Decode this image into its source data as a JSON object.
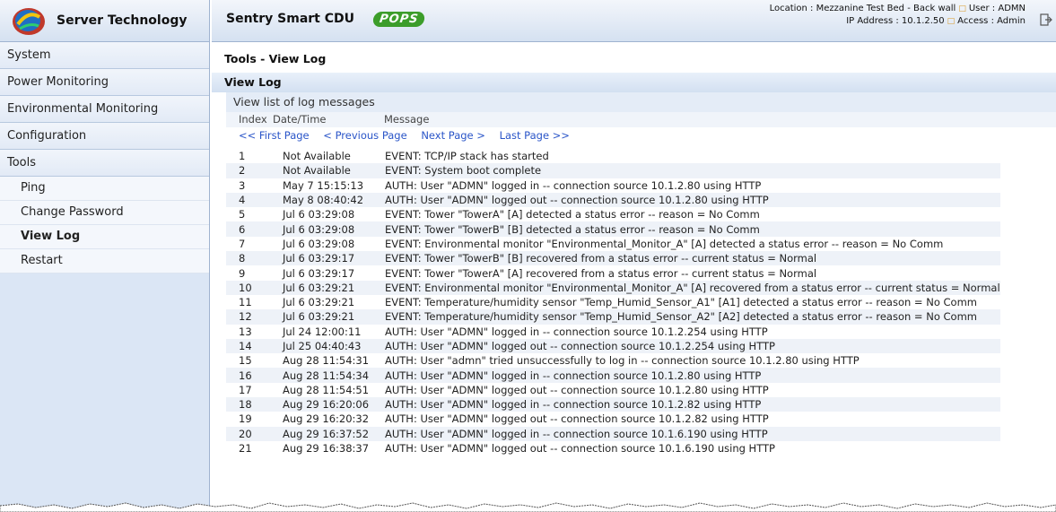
{
  "brand": {
    "name": "Server Technology"
  },
  "header": {
    "product": "Sentry Smart CDU",
    "badge": "POPS",
    "location_label": "Location : Mezzanine Test Bed - Back wall",
    "user_label": "User : ADMN",
    "ip_label": "IP Address : 10.1.2.50",
    "access_label": "Access : Admin"
  },
  "sidebar": {
    "items": [
      {
        "label": "System"
      },
      {
        "label": "Power Monitoring"
      },
      {
        "label": "Environmental Monitoring"
      },
      {
        "label": "Configuration"
      },
      {
        "label": "Tools"
      }
    ],
    "subitems": [
      {
        "label": "Ping"
      },
      {
        "label": "Change Password"
      },
      {
        "label": "View Log"
      },
      {
        "label": "Restart"
      }
    ]
  },
  "main": {
    "page_title": "Tools - View Log",
    "section": "View Log",
    "subsection": "View list of log messages",
    "columns": [
      "Index",
      "Date/Time",
      "Message"
    ],
    "pager": [
      "<< First Page",
      "< Previous Page",
      "Next Page >",
      "Last Page >>"
    ],
    "rows": [
      {
        "index": "1",
        "datetime": "Not Available",
        "message": "EVENT: TCP/IP stack has started"
      },
      {
        "index": "2",
        "datetime": "Not Available",
        "message": "EVENT: System boot complete"
      },
      {
        "index": "3",
        "datetime": "May 7 15:15:13",
        "message": "AUTH: User \"ADMN\" logged in -- connection source 10.1.2.80 using HTTP"
      },
      {
        "index": "4",
        "datetime": "May 8 08:40:42",
        "message": "AUTH: User \"ADMN\" logged out -- connection source 10.1.2.80 using HTTP"
      },
      {
        "index": "5",
        "datetime": "Jul 6 03:29:08",
        "message": "EVENT: Tower \"TowerA\" [A] detected a status error -- reason = No Comm"
      },
      {
        "index": "6",
        "datetime": "Jul 6 03:29:08",
        "message": "EVENT: Tower \"TowerB\" [B] detected a status error -- reason = No Comm"
      },
      {
        "index": "7",
        "datetime": "Jul 6 03:29:08",
        "message": "EVENT: Environmental monitor \"Environmental_Monitor_A\" [A] detected a status error -- reason = No Comm"
      },
      {
        "index": "8",
        "datetime": "Jul 6 03:29:17",
        "message": "EVENT: Tower \"TowerB\" [B] recovered from a status error -- current status = Normal"
      },
      {
        "index": "9",
        "datetime": "Jul 6 03:29:17",
        "message": "EVENT: Tower \"TowerA\" [A] recovered from a status error -- current status = Normal"
      },
      {
        "index": "10",
        "datetime": "Jul 6 03:29:21",
        "message": "EVENT: Environmental monitor \"Environmental_Monitor_A\" [A] recovered from a status error -- current status = Normal"
      },
      {
        "index": "11",
        "datetime": "Jul 6 03:29:21",
        "message": "EVENT: Temperature/humidity sensor \"Temp_Humid_Sensor_A1\" [A1] detected a status error -- reason = No Comm"
      },
      {
        "index": "12",
        "datetime": "Jul 6 03:29:21",
        "message": "EVENT: Temperature/humidity sensor \"Temp_Humid_Sensor_A2\" [A2] detected a status error -- reason = No Comm"
      },
      {
        "index": "13",
        "datetime": "Jul 24 12:00:11",
        "message": "AUTH: User \"ADMN\" logged in -- connection source 10.1.2.254 using HTTP"
      },
      {
        "index": "14",
        "datetime": "Jul 25 04:40:43",
        "message": "AUTH: User \"ADMN\" logged out -- connection source 10.1.2.254 using HTTP"
      },
      {
        "index": "15",
        "datetime": "Aug 28 11:54:31",
        "message": "AUTH: User \"admn\" tried unsuccessfully to log in -- connection source 10.1.2.80 using HTTP"
      },
      {
        "index": "16",
        "datetime": "Aug 28 11:54:34",
        "message": "AUTH: User \"ADMN\" logged in -- connection source 10.1.2.80 using HTTP"
      },
      {
        "index": "17",
        "datetime": "Aug 28 11:54:51",
        "message": "AUTH: User \"ADMN\" logged out -- connection source 10.1.2.80 using HTTP"
      },
      {
        "index": "18",
        "datetime": "Aug 29 16:20:06",
        "message": "AUTH: User \"ADMN\" logged in -- connection source 10.1.2.82 using HTTP"
      },
      {
        "index": "19",
        "datetime": "Aug 29 16:20:32",
        "message": "AUTH: User \"ADMN\" logged out -- connection source 10.1.2.82 using HTTP"
      },
      {
        "index": "20",
        "datetime": "Aug 29 16:37:52",
        "message": "AUTH: User \"ADMN\" logged in -- connection source 10.1.6.190 using HTTP"
      },
      {
        "index": "21",
        "datetime": "Aug 29 16:38:37",
        "message": "AUTH: User \"ADMN\" logged out -- connection source 10.1.6.190 using HTTP"
      }
    ]
  },
  "colors": {
    "sidebar_bg": "#dbe6f5",
    "header_bg": "#d5e1f1",
    "link": "#2a55c8",
    "badge_green": "#3c9d2a",
    "separator": "#d89a2a"
  }
}
